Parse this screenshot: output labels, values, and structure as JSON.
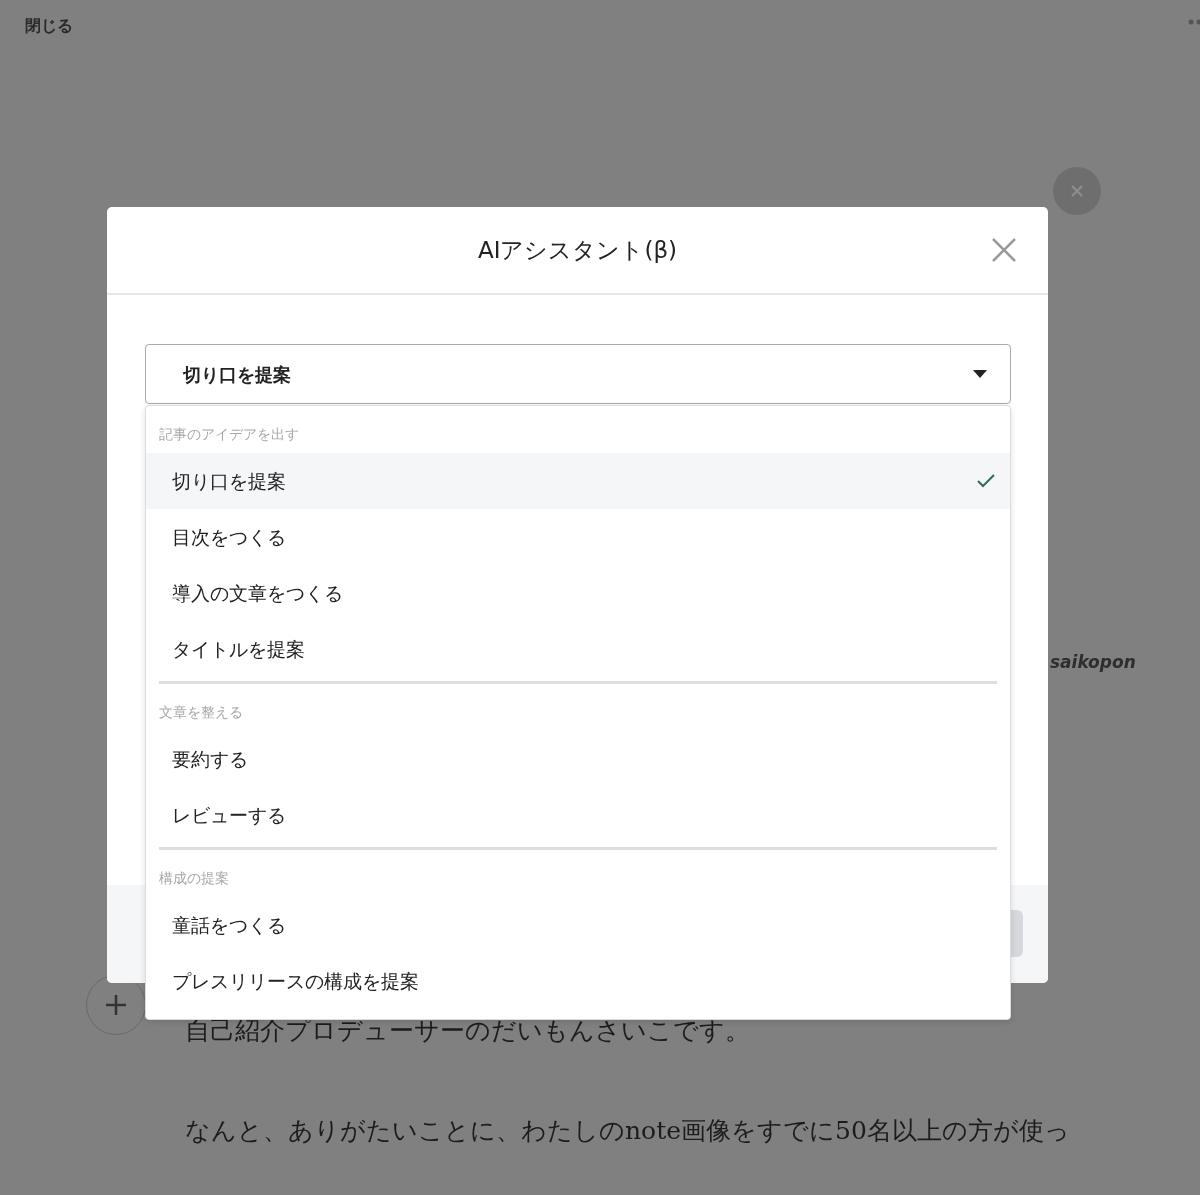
{
  "page": {
    "close_label": "閉じる",
    "author": "saikopon",
    "paragraphs": [
      "自己紹介プロデューサーのだいもんさいこです。",
      "なんと、ありがたいことに、わたしのnote画像をすでに50名以上の方が使っ"
    ]
  },
  "modal": {
    "title": "AIアシスタント(β)",
    "select": {
      "value": "切り口を提案",
      "expanded": true
    },
    "groups": [
      {
        "heading": "記事のアイデアを出す",
        "items": [
          {
            "label": "切り口を提案",
            "selected": true
          },
          {
            "label": "目次をつくる",
            "selected": false
          },
          {
            "label": "導入の文章をつくる",
            "selected": false
          },
          {
            "label": "タイトルを提案",
            "selected": false
          }
        ]
      },
      {
        "heading": "文章を整える",
        "items": [
          {
            "label": "要約する",
            "selected": false
          },
          {
            "label": "レビューする",
            "selected": false
          }
        ]
      },
      {
        "heading": "構成の提案",
        "items": [
          {
            "label": "童話をつくる",
            "selected": false
          },
          {
            "label": "プレスリリースの構成を提案",
            "selected": false
          }
        ]
      }
    ]
  }
}
